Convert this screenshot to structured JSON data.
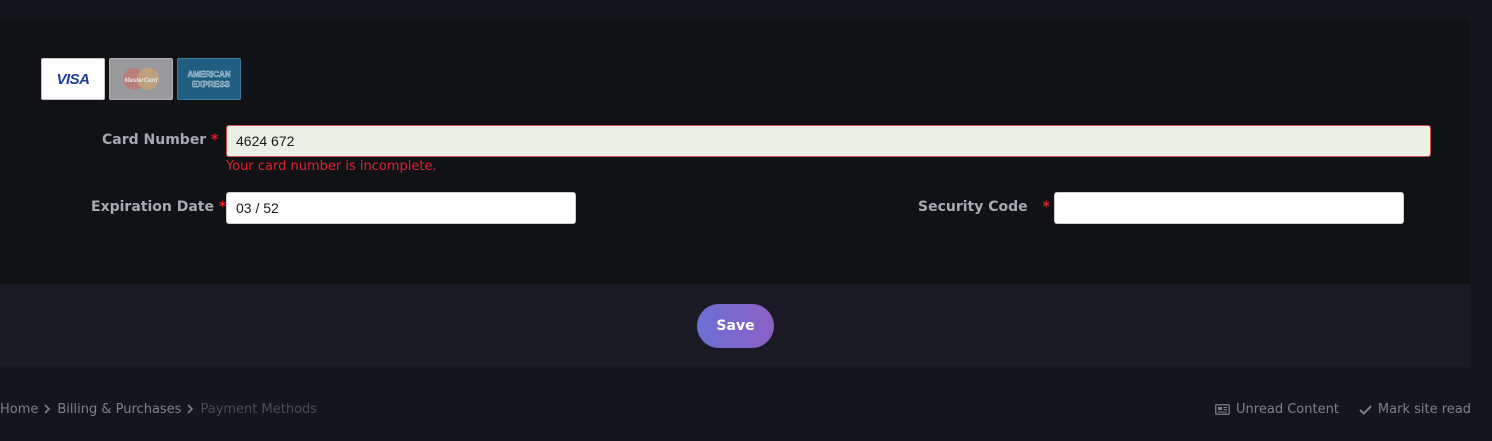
{
  "form": {
    "card_number": {
      "label": "Card Number",
      "required_mark": "*",
      "value": "4624 672",
      "error": "Your card number is incomplete."
    },
    "expiration_date": {
      "label": "Expiration Date",
      "required_mark": "*",
      "value": "03 / 52"
    },
    "security_code": {
      "label": "Security Code",
      "required_mark": "*",
      "value": ""
    }
  },
  "card_logos": {
    "visa": "VISA",
    "mastercard": "MasterCard",
    "amex_line1": "AMERICAN",
    "amex_line2": "EXPRESS"
  },
  "actions": {
    "save_label": "Save"
  },
  "breadcrumb": {
    "items": [
      "Home",
      "Billing & Purchases"
    ],
    "current": "Payment Methods"
  },
  "footer_links": {
    "unread": "Unread Content",
    "mark_read": "Mark site read"
  },
  "colors": {
    "background": "#15161b",
    "panel": "#111216",
    "footer_panel": "#191a23",
    "error": "#d8262d",
    "accent_start": "#6c6fd4",
    "accent_end": "#8a60c4"
  }
}
